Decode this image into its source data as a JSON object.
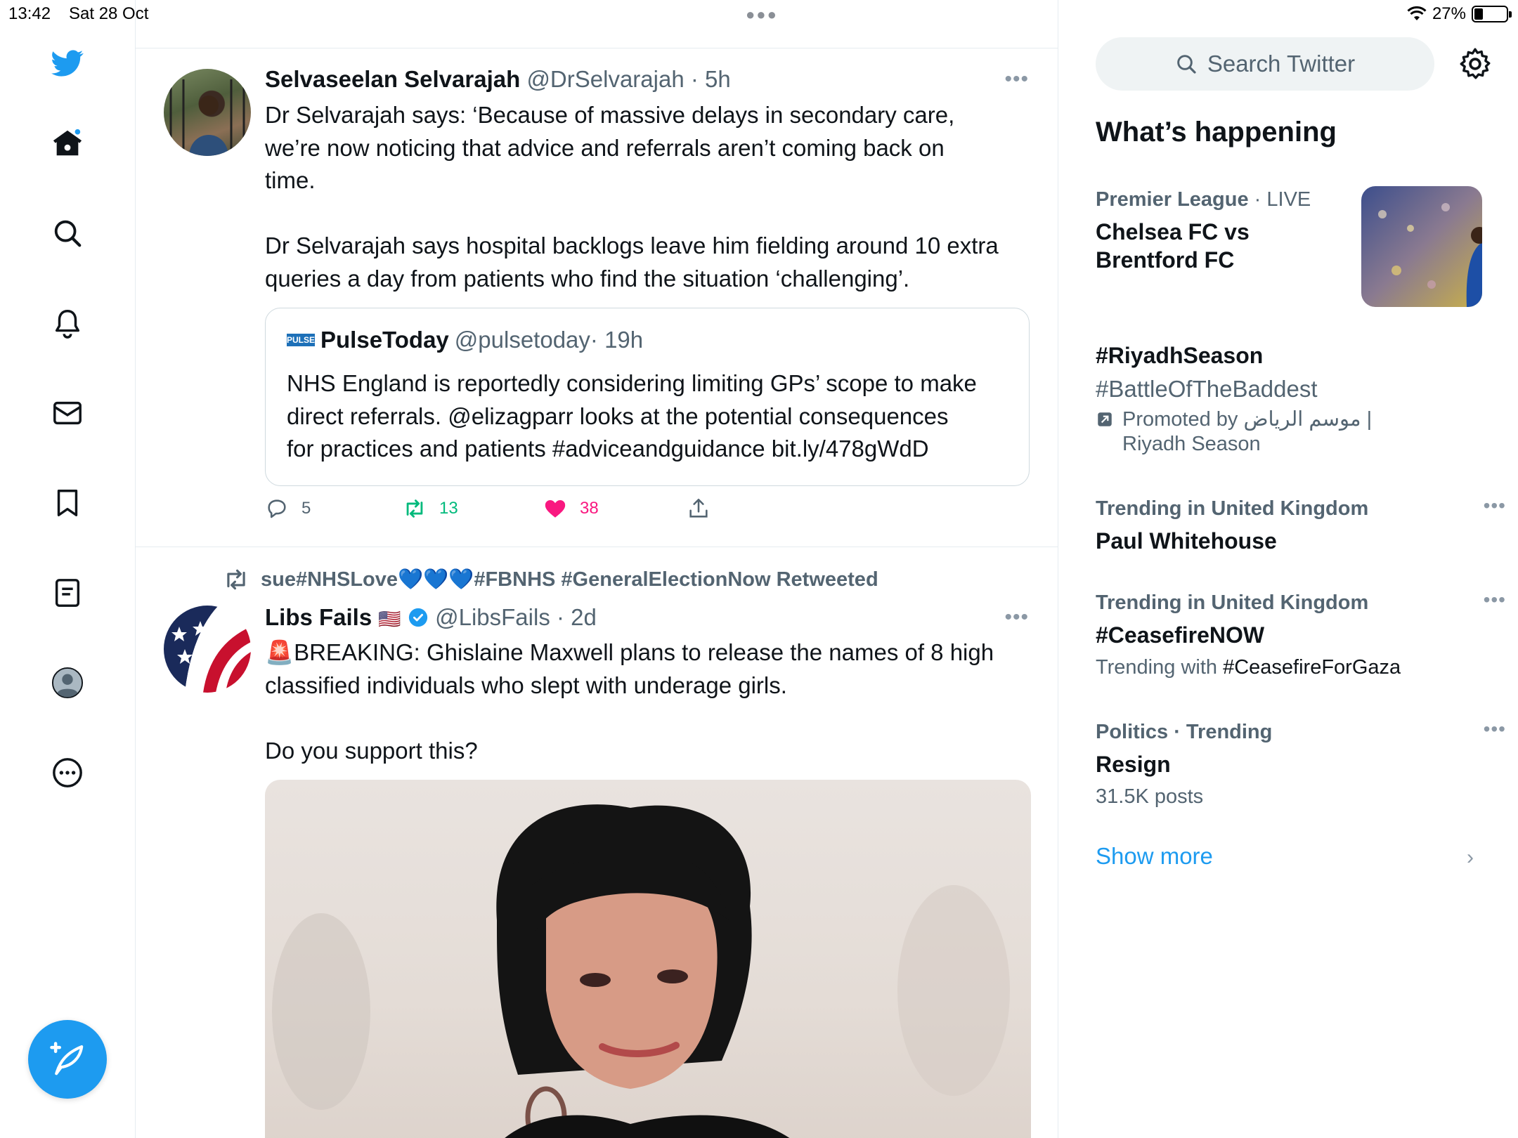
{
  "status_bar": {
    "time": "13:42",
    "date": "Sat 28 Oct",
    "battery": "27%",
    "battery_level": 0.27
  },
  "nav": {
    "icons": [
      "twitter-logo-icon",
      "home-icon",
      "search-icon",
      "bell-icon",
      "mail-icon",
      "bookmark-icon",
      "lists-icon",
      "profile-icon",
      "more-icon"
    ],
    "compose_icon": "compose-tweet-icon"
  },
  "tweets": [
    {
      "name": "Selvaseelan Selvarajah",
      "handle": "@DrSelvarajah",
      "time": "· 5h",
      "text_1": "Dr Selvarajah says: ‘Because of massive delays in secondary care,",
      "text_2": "we’re now noticing that advice and referrals aren’t coming back on",
      "text_3": "time.",
      "text_4": "Dr Selvarajah says hospital backlogs leave him fielding around 10 extra",
      "text_5": "queries a day from patients who find the situation ‘challenging’.",
      "quote": {
        "logo_text": "PULSE",
        "name": "PulseToday",
        "handle": "@pulsetoday",
        "time": "· 19h",
        "text_1": "NHS England is reportedly considering limiting GPs’ scope to make",
        "text_2": "direct referrals. @elizagparr looks at the potential consequences",
        "text_3": "for practices and patients #adviceandguidance bit.ly/478gWdD"
      },
      "replies": "5",
      "retweets": "13",
      "likes": "38"
    },
    {
      "retweeted_by": "sue#NHSLove💙💙💙#FBNHS #GeneralElectionNow Retweeted",
      "name": "Libs Fails",
      "flag": "🇺🇸",
      "handle": "@LibsFails",
      "time": "· 2d",
      "text_1": "🚨BREAKING: Ghislaine Maxwell plans to release the names of 8 high",
      "text_2": "classified individuals who slept with underage girls.",
      "text_3": "Do you support this?"
    }
  ],
  "sidebar": {
    "search_placeholder": "Search Twitter",
    "title": "What’s happening",
    "trends": [
      {
        "context_bold": "Premier League",
        "context_rest": " · LIVE",
        "title_1": "Chelsea FC vs",
        "title_2": "Brentford FC"
      },
      {
        "title": "#RiyadhSeason",
        "subtitle": "#BattleOfTheBaddest",
        "promoted_1": "Promoted by موسم الرياض |",
        "promoted_2": "Riyadh Season"
      },
      {
        "context": "Trending in United Kingdom",
        "title": "Paul Whitehouse"
      },
      {
        "context": "Trending in United Kingdom",
        "title": "#CeasefireNOW",
        "sub_prefix": "Trending with ",
        "sub_tag": "#CeasefireForGaza"
      },
      {
        "context": "Politics · Trending",
        "title": "Resign",
        "posts": "31.5K posts"
      }
    ],
    "show_more": "Show more"
  },
  "colors": {
    "accent": "#1d9bf0",
    "like": "#f91880",
    "retweet": "#00ba7c"
  }
}
